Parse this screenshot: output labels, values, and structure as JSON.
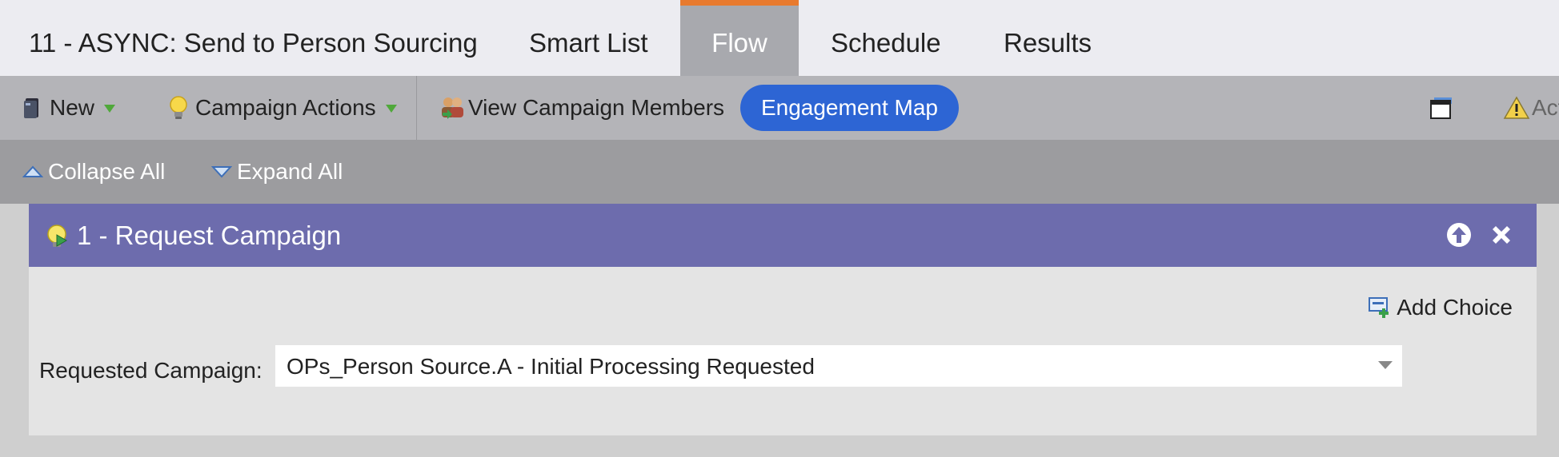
{
  "tabs": [
    {
      "label": "11 - ASYNC: Send to Person Sourcing",
      "active": false
    },
    {
      "label": "Smart List",
      "active": false
    },
    {
      "label": "Flow",
      "active": true
    },
    {
      "label": "Schedule",
      "active": false
    },
    {
      "label": "Results",
      "active": false
    }
  ],
  "toolbar": {
    "new_label": "New",
    "campaign_actions_label": "Campaign Actions",
    "view_members_label": "View Campaign Members",
    "engagement_map_label": "Engagement Map",
    "truncated_label": "Act"
  },
  "collapse_bar": {
    "collapse_label": "Collapse All",
    "expand_label": "Expand All"
  },
  "flow_step": {
    "title": "1 - Request Campaign",
    "add_choice_label": "Add Choice",
    "field_label": "Requested Campaign:",
    "field_value": "OPs_Person Source.A - Initial Processing Requested"
  },
  "colors": {
    "accent_tab": "#e87a2e",
    "pill": "#2d65d4",
    "panel_header": "#6d6cad"
  }
}
